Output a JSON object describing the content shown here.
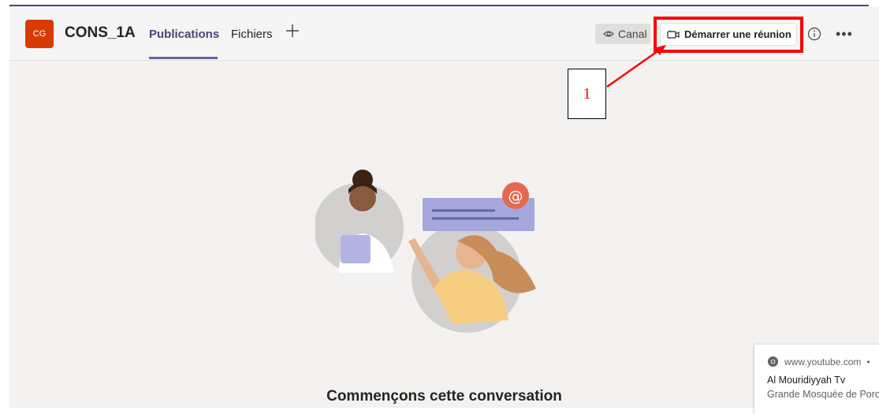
{
  "team": {
    "initials": "CG",
    "name": "CONS_1A"
  },
  "tabs": [
    {
      "label": "Publications",
      "active": true
    },
    {
      "label": "Fichiers",
      "active": false
    }
  ],
  "add_tab_icon": "plus-icon",
  "toolbar": {
    "canal_label": "Canal",
    "meeting_label": "Démarrer une réunion",
    "info_icon": "info-icon",
    "more_icon": "more-icon"
  },
  "annotation": {
    "number": "1",
    "color": "#ff0000"
  },
  "empty_state": {
    "title": "Commençons cette conversation"
  },
  "toast": {
    "site": "www.youtube.com",
    "separator": "•",
    "title": "Al Mouridiyyah Tv",
    "description": "Grande Mosquée de Porokhane splendeur"
  },
  "colors": {
    "accent": "#6264a7",
    "avatar_bg": "#d83b01",
    "annotation": "#ff0000"
  }
}
